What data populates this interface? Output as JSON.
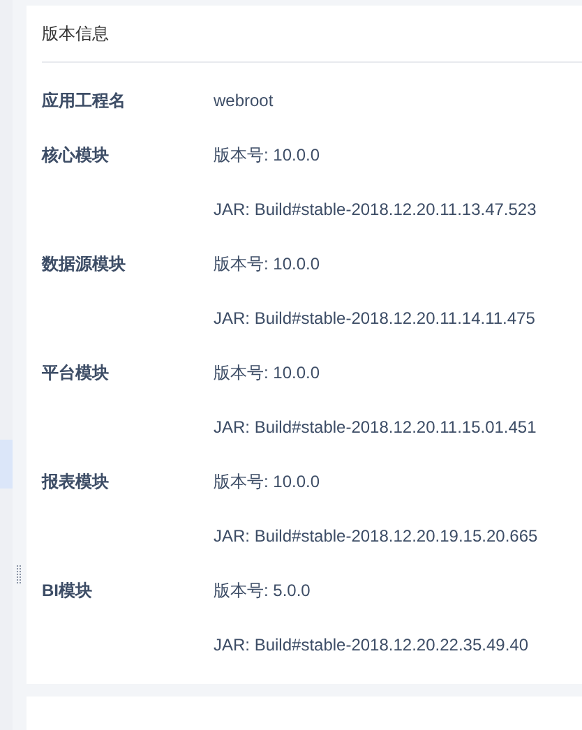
{
  "panel": {
    "title": "版本信息"
  },
  "rows": [
    {
      "label": "应用工程名",
      "values": [
        "webroot"
      ]
    },
    {
      "label": "核心模块",
      "values": [
        "版本号: 10.0.0",
        "JAR: Build#stable-2018.12.20.11.13.47.523"
      ]
    },
    {
      "label": "数据源模块",
      "values": [
        "版本号: 10.0.0",
        "JAR: Build#stable-2018.12.20.11.14.11.475"
      ]
    },
    {
      "label": "平台模块",
      "values": [
        "版本号: 10.0.0",
        "JAR: Build#stable-2018.12.20.11.15.01.451"
      ]
    },
    {
      "label": "报表模块",
      "values": [
        "版本号: 10.0.0",
        "JAR: Build#stable-2018.12.20.19.15.20.665"
      ]
    },
    {
      "label": "BI模块",
      "values": [
        "版本号: 5.0.0",
        "JAR: Build#stable-2018.12.20.22.35.49.40"
      ]
    }
  ]
}
